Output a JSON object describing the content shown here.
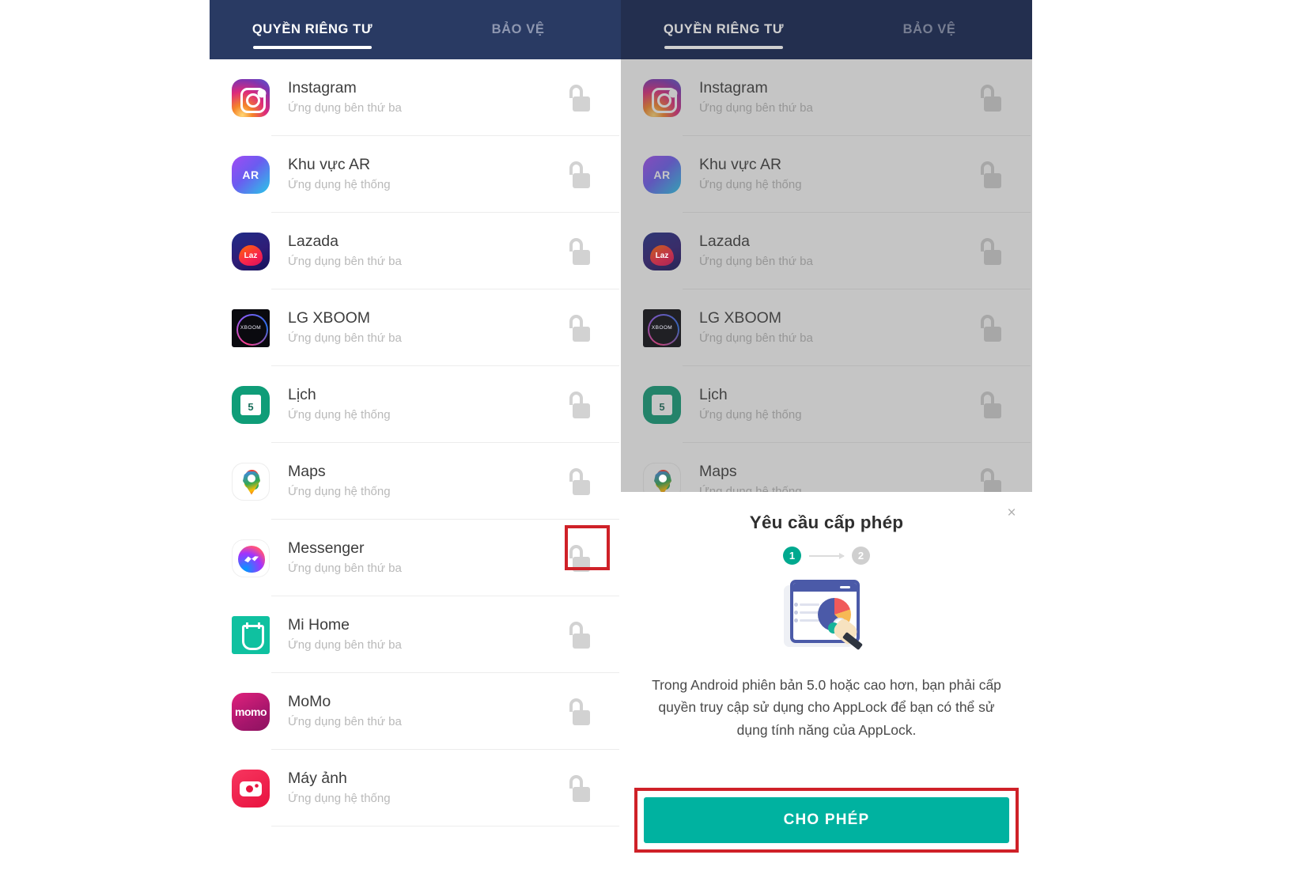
{
  "tabs": [
    {
      "label": "QUYỀN RIÊNG TƯ",
      "active": true
    },
    {
      "label": "BẢO VỆ",
      "active": false
    }
  ],
  "labels": {
    "third_party": "Ứng dụng bên thứ ba",
    "system": "Ứng dụng hệ thống"
  },
  "apps": [
    {
      "name": "Instagram",
      "sub": "Ứng dụng bên thứ ba",
      "icon": "instagram-icon",
      "icon_text": ""
    },
    {
      "name": "Khu vực AR",
      "sub": "Ứng dụng hệ thống",
      "icon": "ar-zone-icon",
      "icon_text": "AR"
    },
    {
      "name": "Lazada",
      "sub": "Ứng dụng bên thứ ba",
      "icon": "lazada-icon",
      "icon_text": "Laz"
    },
    {
      "name": "LG XBOOM",
      "sub": "Ứng dụng bên thứ ba",
      "icon": "lg-xboom-icon",
      "icon_text": "XBOOM"
    },
    {
      "name": "Lịch",
      "sub": "Ứng dụng hệ thống",
      "icon": "calendar-icon",
      "icon_text": "5"
    },
    {
      "name": "Maps",
      "sub": "Ứng dụng hệ thống",
      "icon": "maps-icon",
      "icon_text": ""
    },
    {
      "name": "Messenger",
      "sub": "Ứng dụng bên thứ ba",
      "icon": "messenger-icon",
      "icon_text": ""
    },
    {
      "name": "Mi Home",
      "sub": "Ứng dụng bên thứ ba",
      "icon": "mi-home-icon",
      "icon_text": ""
    },
    {
      "name": "MoMo",
      "sub": "Ứng dụng bên thứ ba",
      "icon": "momo-icon",
      "icon_text": "momo"
    },
    {
      "name": "Máy ảnh",
      "sub": "Ứng dụng hệ thống",
      "icon": "camera-icon",
      "icon_text": ""
    }
  ],
  "right_apps": [
    {
      "name": "Instagram",
      "sub": "Ứng dụng bên thứ ba",
      "icon": "instagram-icon",
      "icon_text": ""
    },
    {
      "name": "Khu vực AR",
      "sub": "Ứng dụng hệ thống",
      "icon": "ar-zone-icon",
      "icon_text": "AR"
    },
    {
      "name": "Lazada",
      "sub": "Ứng dụng bên thứ ba",
      "icon": "lazada-icon",
      "icon_text": "Laz"
    },
    {
      "name": "LG XBOOM",
      "sub": "Ứng dụng bên thứ ba",
      "icon": "lg-xboom-icon",
      "icon_text": "XBOOM"
    },
    {
      "name": "Lịch",
      "sub": "Ứng dụng hệ thống",
      "icon": "calendar-icon",
      "icon_text": "5"
    },
    {
      "name": "Maps",
      "sub": "Ứng dụng hệ thống",
      "icon": "maps-icon",
      "icon_text": ""
    }
  ],
  "dialog": {
    "close": "×",
    "title": "Yêu cầu cấp phép",
    "step_current": "1",
    "step_next": "2",
    "description": "Trong Android phiên bản 5.0 hoặc cao hơn, bạn phải cấp quyền truy cập sử dụng cho AppLock để bạn có thể sử dụng tính năng của AppLock.",
    "allow_button": "CHO PHÉP"
  },
  "colors": {
    "tabbar": "#293a63",
    "accent_teal": "#00b2a0",
    "step_done": "#00a98f",
    "highlight_red": "#cf2128",
    "lock_grey": "#d2d2d2"
  }
}
